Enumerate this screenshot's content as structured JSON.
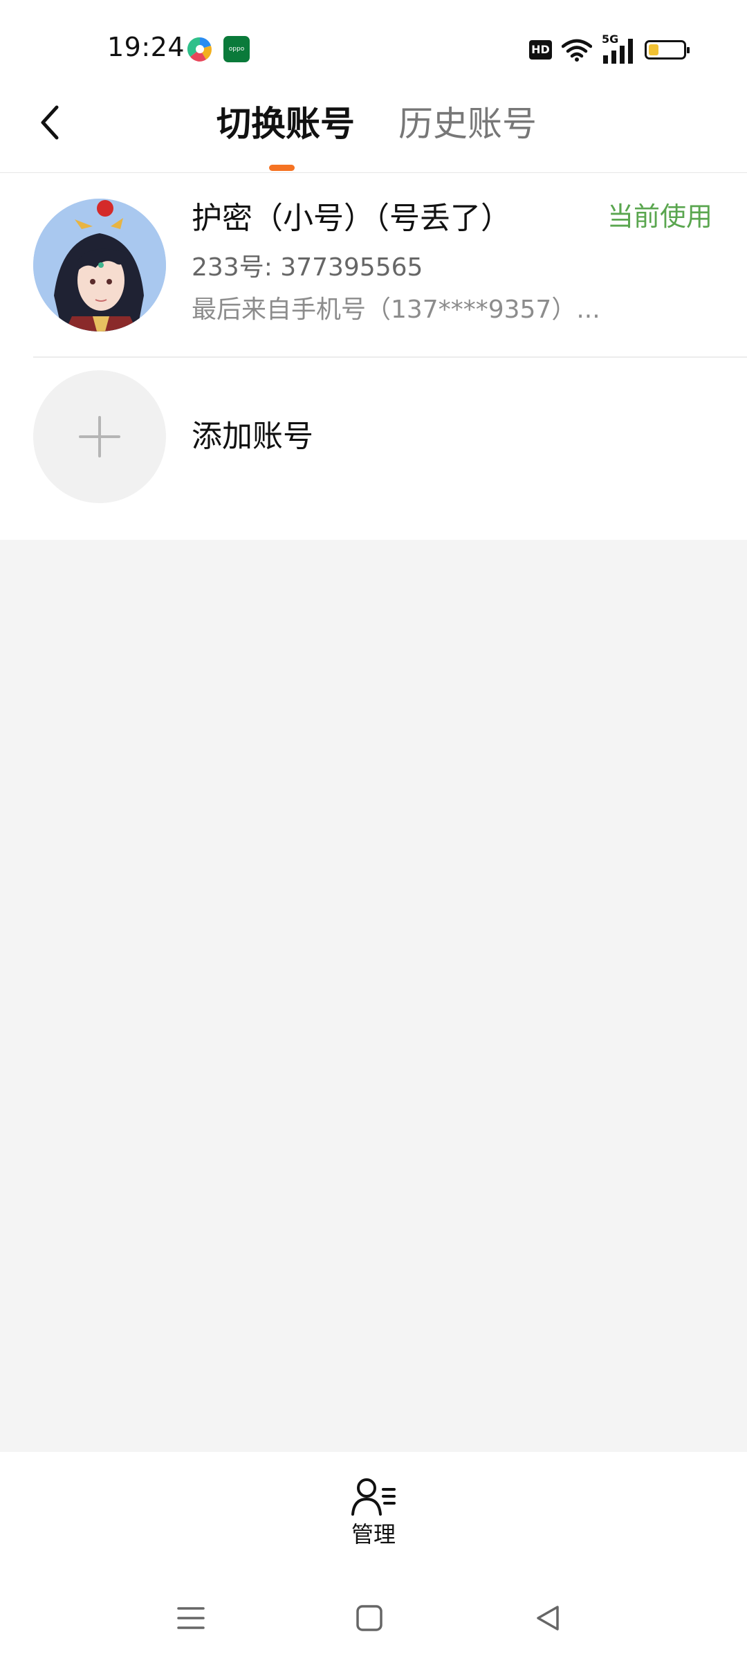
{
  "status_bar": {
    "time": "19:24",
    "app_icons": [
      "multicolor-app-icon",
      "oppo-app-icon"
    ],
    "oppo_icon_text": "oppo",
    "hd_label": "HD",
    "network_label": "5G",
    "battery_level_fraction": 0.3,
    "colors": {
      "battery_fill": "#f2c233",
      "oppo_icon": "#0a7a3a"
    }
  },
  "header": {
    "back_icon": "chevron-left-icon",
    "tabs": [
      {
        "label": "切换账号",
        "active": true
      },
      {
        "label": "历史账号",
        "active": false
      }
    ],
    "accent_color": "#f57323"
  },
  "accounts": [
    {
      "name": "护密（小号）（号丢了）",
      "id_text": "233号: 377395565",
      "last_login": "最后来自手机号（137****9357）...",
      "current_label": "当前使用",
      "current_color": "#5aa64f",
      "avatar_icon": "anime-avatar-icon"
    }
  ],
  "add_account": {
    "label": "添加账号",
    "icon": "plus-icon"
  },
  "manage": {
    "label": "管理",
    "icon": "user-manage-icon"
  },
  "nav_bar": {
    "buttons": [
      "menu-icon",
      "home-square-icon",
      "back-triangle-icon"
    ]
  }
}
